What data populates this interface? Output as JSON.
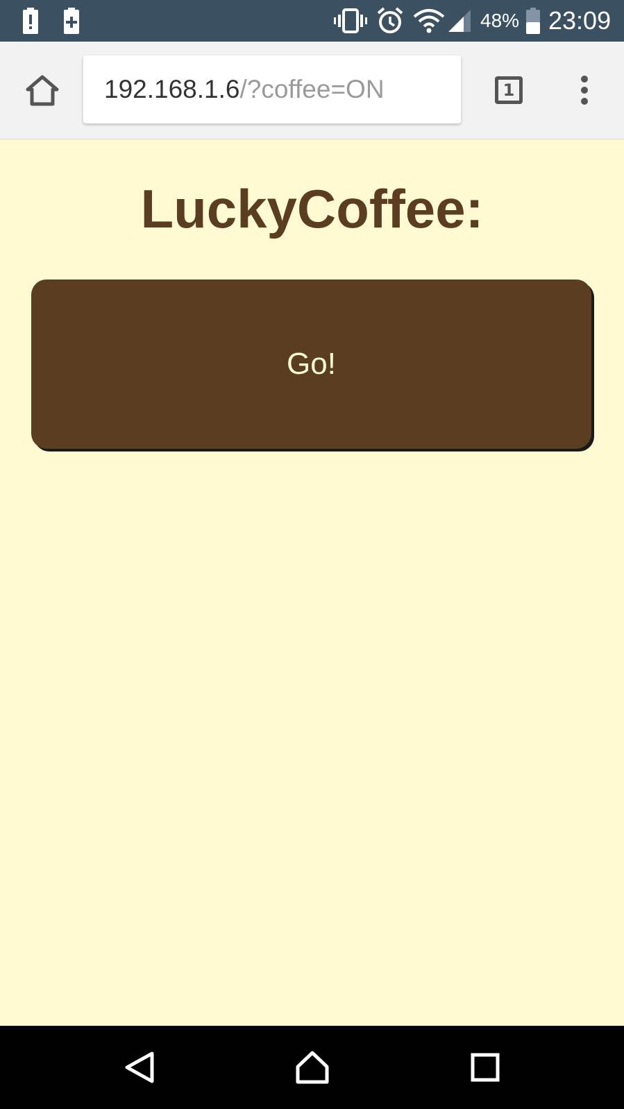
{
  "status_bar": {
    "battery_percent": "48%",
    "time": "23:09",
    "icons": [
      "alert-notification-icon",
      "battery-plus-notification-icon",
      "vibrate-icon",
      "alarm-icon",
      "wifi-icon",
      "cell-signal-icon",
      "battery-icon"
    ]
  },
  "browser": {
    "url_host": "192.168.1.6",
    "url_path": "/?coffee=ON",
    "tab_count": "1"
  },
  "page": {
    "title": "LuckyCoffee:",
    "go_button_label": "Go!"
  },
  "colors": {
    "status_bar_bg": "#3b5061",
    "page_bg": "#fffad2",
    "brand_brown": "#5b3d21",
    "toolbar_bg": "#f2f2f2",
    "nav_bar_bg": "#000000"
  },
  "nav_bar": {
    "buttons": [
      "back-icon",
      "home-icon",
      "recents-icon"
    ]
  }
}
